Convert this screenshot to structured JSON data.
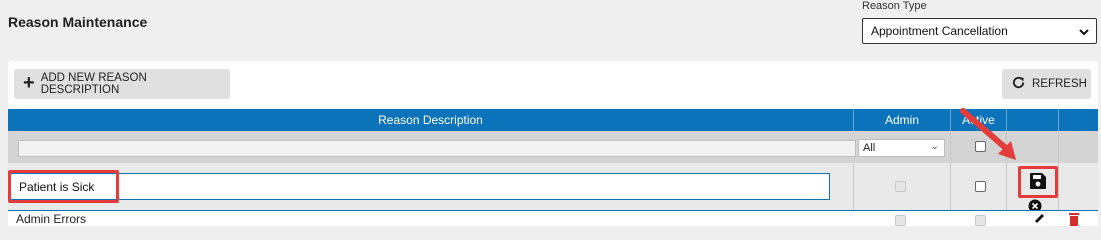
{
  "page": {
    "title": "Reason Maintenance"
  },
  "reason_type": {
    "label": "Reason Type",
    "selected": "Appointment Cancellation"
  },
  "toolbar": {
    "add_label": "ADD NEW REASON DESCRIPTION",
    "refresh_label": "REFRESH"
  },
  "table": {
    "columns": [
      "Reason Description",
      "Admin",
      "Active"
    ],
    "filter": {
      "description_value": "",
      "admin_selected": "All"
    },
    "edit_row": {
      "description_value": "Patient is Sick"
    },
    "next_row": {
      "description": "Admin Errors"
    }
  },
  "colors": {
    "header_bg": "#0b73b9",
    "highlight": "#e43b3b",
    "delete_icon": "#d32f2f"
  }
}
